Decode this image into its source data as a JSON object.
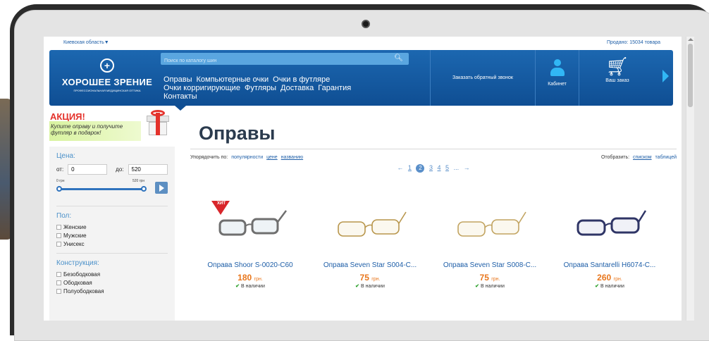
{
  "topbar": {
    "region": "Киевская область▼",
    "sold": "Продано: 15034 товара"
  },
  "header": {
    "logo_name": "ХОРОШЕЕ ЗРЕНИЕ",
    "logo_tagline": "ПРОФЕССИОНАЛЬНАЯ МЕДИЦИНСКАЯ ОПТИКА",
    "search_placeholder": "Поиск по каталогу шин",
    "nav": [
      "Оправы",
      "Компьютерные очки",
      "Очки в футляре",
      "Очки корригирующие",
      "Футляры",
      "Доставка",
      "Гарантия",
      "Контакты"
    ],
    "callback": "Заказать обратный звонок",
    "cabinet": "Кабинет",
    "order": "Ваш заказ"
  },
  "sidebar": {
    "promo_title": "АКЦИЯ!",
    "promo_text": "Купите оправу и получите футляр в подарок!",
    "price_heading": "Цена:",
    "from_label": "от:",
    "from_value": "0",
    "to_label": "до:",
    "to_value": "520",
    "slider_min": "0 грн",
    "slider_max": "520 грн",
    "gender_heading": "Пол:",
    "gender_options": [
      "Женские",
      "Мужские",
      "Унисекс"
    ],
    "construction_heading": "Конструкция:",
    "construction_options": [
      "Безободковая",
      "Ободковая",
      "Полуободковая"
    ]
  },
  "main": {
    "title": "Оправы",
    "sort_label": "Упорядочить по:",
    "sort_options": [
      "популярности",
      "цене",
      "названию"
    ],
    "display_label": "Отобразить:",
    "display_options": [
      "списком",
      "таблицей"
    ],
    "pager": {
      "prev": "←",
      "pages": [
        "1",
        "2",
        "3",
        "4",
        "5"
      ],
      "current": "2",
      "ellipsis": "...",
      "next": "→"
    }
  },
  "products": [
    {
      "name": "Оправа Shoor S-0020-C60",
      "price": "180",
      "currency": "грн.",
      "stock": "В наличии",
      "badge": "ХИТ",
      "frame_color": "#6f6f6f"
    },
    {
      "name": "Оправа Seven Star S004-C...",
      "price": "75",
      "currency": "грн.",
      "stock": "В наличии",
      "badge": "",
      "frame_color": "#b8964c"
    },
    {
      "name": "Оправа Seven Star S008-C...",
      "price": "75",
      "currency": "грн.",
      "stock": "В наличии",
      "badge": "",
      "frame_color": "#c2a461"
    },
    {
      "name": "Оправа Santarelli H6074-C...",
      "price": "260",
      "currency": "грн.",
      "stock": "В наличии",
      "badge": "",
      "frame_color": "#2f3566"
    }
  ],
  "colors": {
    "header_blue": "#1c67b0",
    "accent_light_blue": "#31b7f5",
    "promo_red": "#e4322b",
    "price_orange": "#e8761c",
    "link_blue": "#1f5fa8"
  }
}
